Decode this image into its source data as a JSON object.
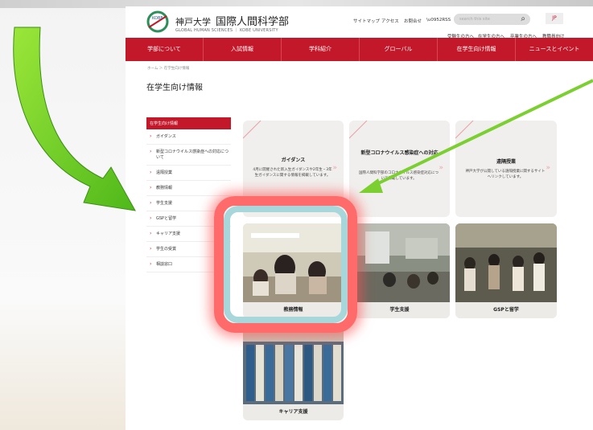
{
  "header": {
    "logo_badge": "KOBE",
    "university": "神戸大学",
    "faculty": "国際人間科学部",
    "logo_en": "GLOBAL HUMAN SCIENCES ｜ KOBE UNIVERSITY",
    "util_links": [
      "サイトマップ",
      "アクセス",
      "お問合せ",
      "RSS"
    ],
    "search_placeholder": "search this site",
    "lang": "JP",
    "audience_links": [
      "受験生の方へ",
      "在学生の方へ",
      "卒業生の方へ",
      "教職員向け"
    ]
  },
  "nav": [
    "学部について",
    "入試情報",
    "学科紹介",
    "グローバル",
    "在学生向け情報",
    "ニュースとイベント"
  ],
  "breadcrumb": "ホーム ＞ 在学生向け情報",
  "page_title": "在学生向け情報",
  "sidebar": {
    "head": "在学生向け情報",
    "items": [
      "ガイダンス",
      "新型コロナウイルス感染症への対応について",
      "遠隔授業",
      "教務情報",
      "学生支援",
      "GSPと留学",
      "キャリア支援",
      "学生の受賞",
      "相談窓口"
    ]
  },
  "cards": [
    {
      "title": "ガイダンス",
      "desc": "4月に開催された新入生ガイダンスや2年生・3年生ガイダンスに関する情報を掲載しています。"
    },
    {
      "title": "新型コロナウイルス感染症への対応",
      "desc": "国際人間科学部のコロナウイルス感染症対応について掲載しています。"
    },
    {
      "title": "遠隔授業",
      "desc": "神戸大学が公開している遠隔授業に関するサイトへリンクしています。"
    }
  ],
  "photo_cards": [
    "教務情報",
    "学生支援",
    "GSPと留学",
    "キャリア支援"
  ],
  "colors": {
    "brand": "#c3172a",
    "highlight": "#ff6b6b",
    "highlight_inner": "#a8d7db",
    "arrow": "#6fcf1f"
  }
}
